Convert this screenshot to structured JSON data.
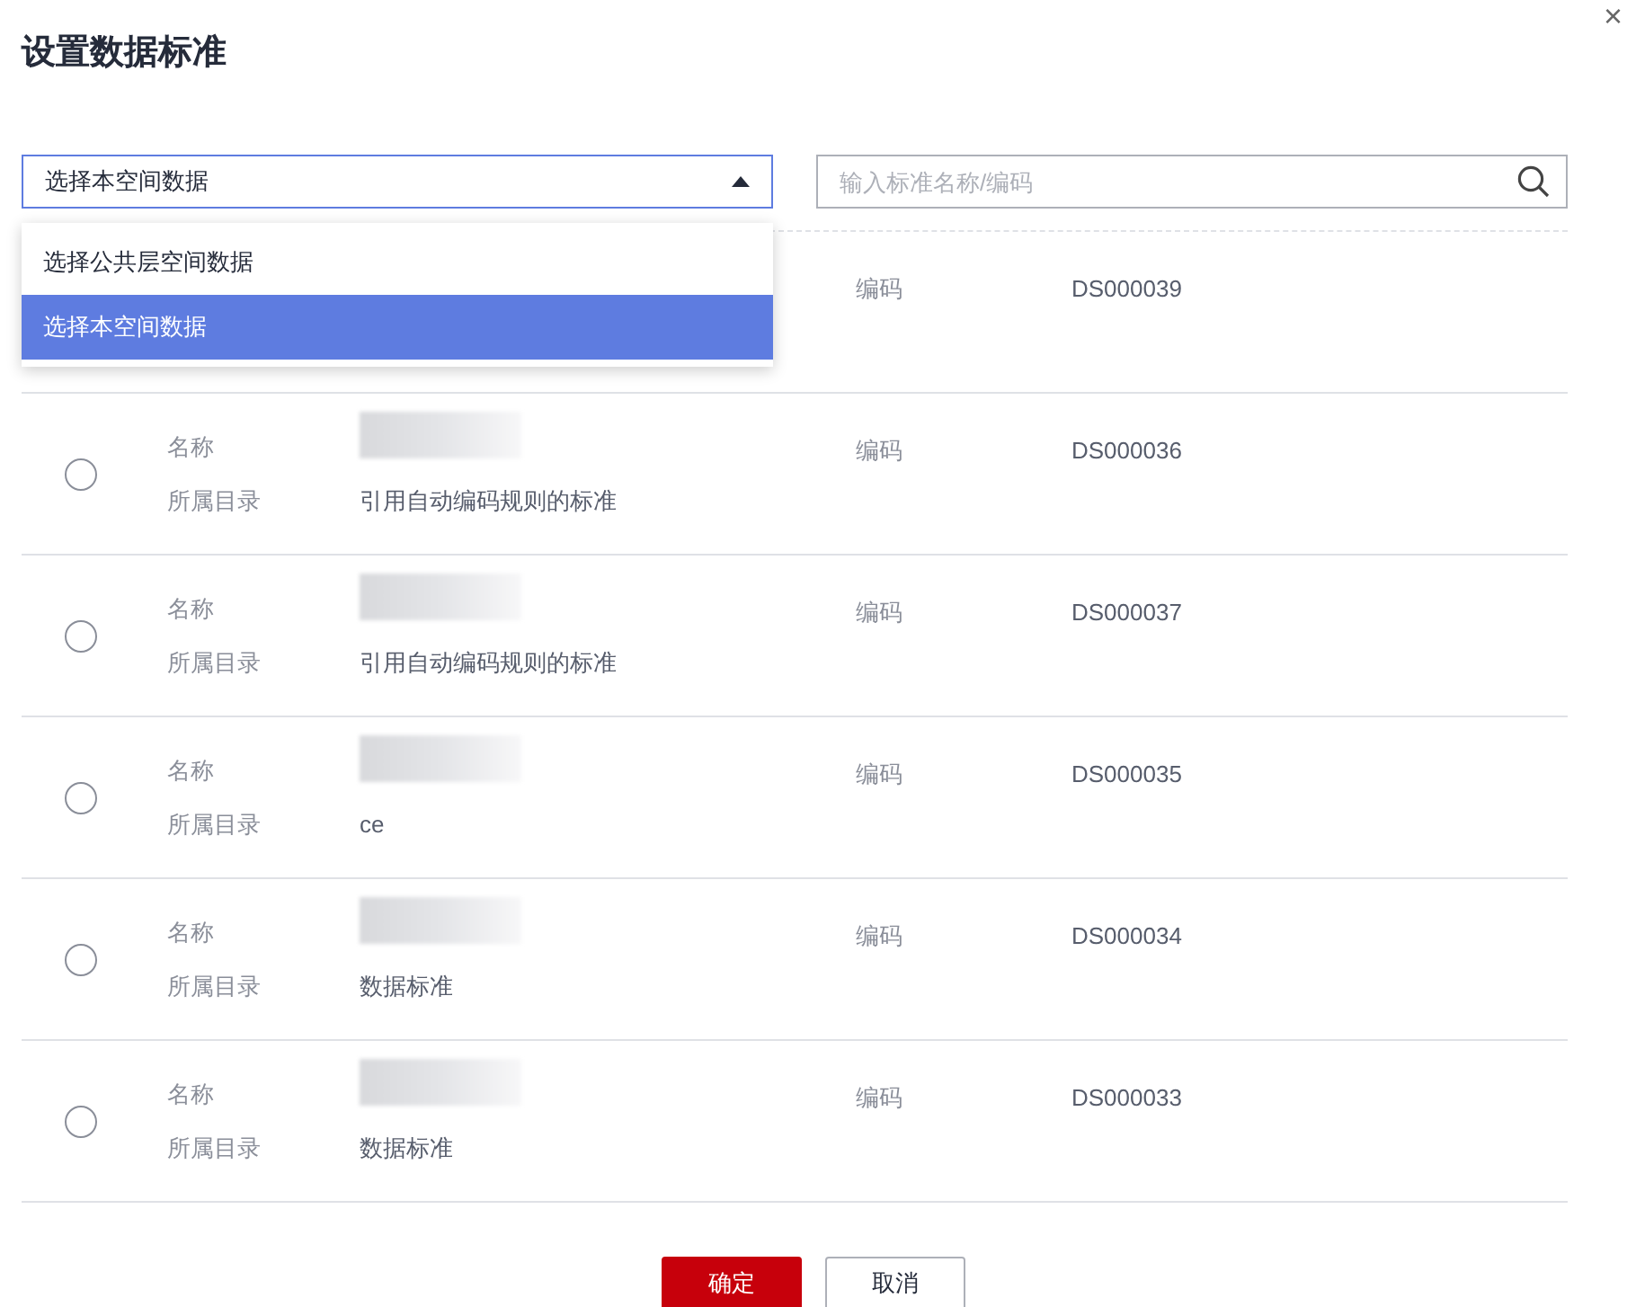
{
  "dialog": {
    "title": "设置数据标准",
    "close": "×"
  },
  "space_select": {
    "value": "选择本空间数据",
    "expanded": true,
    "options": [
      {
        "label": "选择公共层空间数据",
        "selected": false
      },
      {
        "label": "选择本空间数据",
        "selected": true
      }
    ]
  },
  "search": {
    "placeholder": "输入标准名称/编码"
  },
  "rows": [
    {
      "code_label": "编码",
      "code": "DS000039"
    },
    {
      "selected": false,
      "name_label": "名称",
      "name_redacted": true,
      "dir_label": "所属目录",
      "dir": "引用自动编码规则的标准",
      "code_label": "编码",
      "code": "DS000036"
    },
    {
      "selected": false,
      "name_label": "名称",
      "name_redacted": true,
      "dir_label": "所属目录",
      "dir": "引用自动编码规则的标准",
      "code_label": "编码",
      "code": "DS000037"
    },
    {
      "selected": false,
      "name_label": "名称",
      "name_redacted": true,
      "dir_label": "所属目录",
      "dir": "ce",
      "code_label": "编码",
      "code": "DS000035"
    },
    {
      "selected": false,
      "name_label": "名称",
      "name_redacted": true,
      "dir_label": "所属目录",
      "dir": "数据标准",
      "code_label": "编码",
      "code": "DS000034"
    },
    {
      "selected": false,
      "name_label": "名称",
      "name_redacted": true,
      "dir_label": "所属目录",
      "dir": "数据标准",
      "code_label": "编码",
      "code": "DS000033"
    }
  ],
  "buttons": [
    {
      "label": "确定",
      "kind": "primary"
    },
    {
      "label": "取消",
      "kind": "secondary"
    }
  ]
}
